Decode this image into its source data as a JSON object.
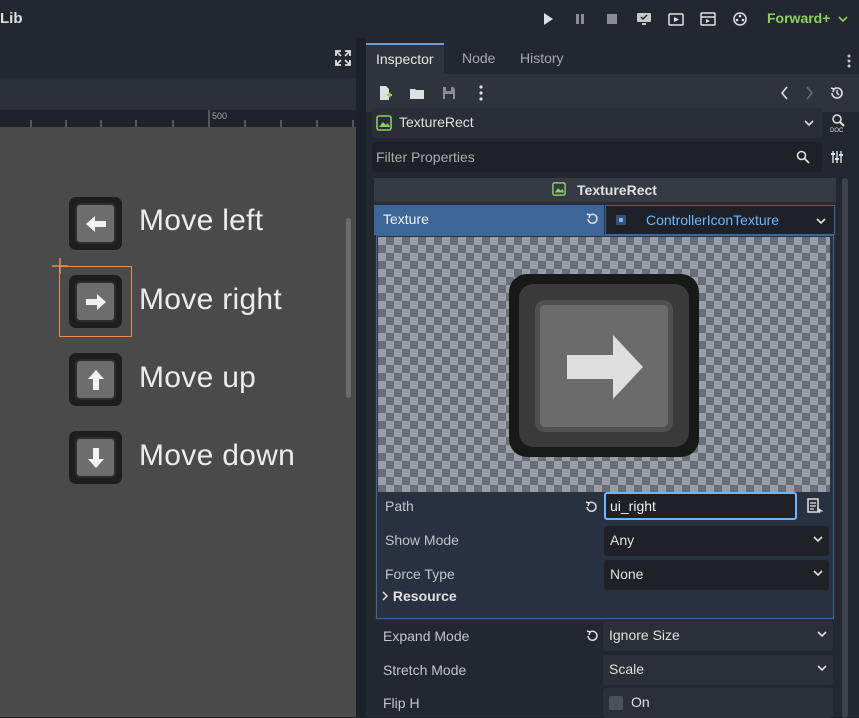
{
  "app": {
    "title": "Lib",
    "renderer": "Forward+"
  },
  "run_controls": [
    {
      "name": "play-icon"
    },
    {
      "name": "pause-icon"
    },
    {
      "name": "stop-icon"
    },
    {
      "name": "remote-debug-icon"
    },
    {
      "name": "play-scene-icon"
    },
    {
      "name": "play-custom-scene-icon"
    },
    {
      "name": "movie-maker-icon"
    }
  ],
  "ruler": {
    "label": "500"
  },
  "canvas": {
    "items": [
      {
        "label": "Move left",
        "icon": "arrow-left-icon"
      },
      {
        "label": "Move right",
        "icon": "arrow-right-icon"
      },
      {
        "label": "Move up",
        "icon": "arrow-up-icon"
      },
      {
        "label": "Move down",
        "icon": "arrow-down-icon"
      }
    ]
  },
  "inspector": {
    "tabs": [
      "Inspector",
      "Node",
      "History"
    ],
    "active_tab": "Inspector",
    "object_name": "TextureRect",
    "filter_placeholder": "Filter Properties",
    "section_title": "TextureRect",
    "texture": {
      "label": "Texture",
      "value": "ControllerIconTexture"
    },
    "resource_props": [
      {
        "label": "Path",
        "value": "ui_right"
      },
      {
        "label": "Show Mode",
        "value": "Any"
      },
      {
        "label": "Force Type",
        "value": "None"
      }
    ],
    "resource_group": "Resource",
    "props": [
      {
        "label": "Expand Mode",
        "value": "Ignore Size"
      },
      {
        "label": "Stretch Mode",
        "value": "Scale"
      },
      {
        "label": "Flip H",
        "value": "On"
      }
    ]
  },
  "colors": {
    "accent": "#6eb6ff",
    "selected_row": "#3e6799",
    "renderer": "#8ed05b",
    "selection": "#e88c55"
  }
}
